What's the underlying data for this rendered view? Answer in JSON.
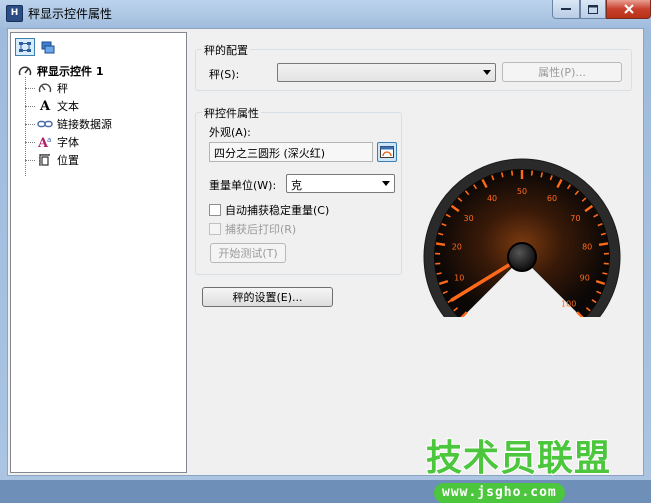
{
  "window": {
    "title": "秤显示控件属性"
  },
  "tree": {
    "root_label": "秤显示控件 1",
    "items": [
      {
        "label": "秤",
        "icon": "scale-gauge-icon"
      },
      {
        "label": "文本",
        "icon": "text-a-icon"
      },
      {
        "label": "链接数据源",
        "icon": "link-icon"
      },
      {
        "label": "字体",
        "icon": "font-icon"
      },
      {
        "label": "位置",
        "icon": "position-icon"
      }
    ]
  },
  "config": {
    "group_title": "秤的配置",
    "scale_label": "秤(S):",
    "scale_value": "",
    "properties_button": "属性(P)..."
  },
  "props": {
    "group_title": "秤控件属性",
    "appearance_label": "外观(A):",
    "appearance_value": "四分之三圆形 (深火红)",
    "unit_label": "重量单位(W):",
    "unit_value": "克",
    "auto_capture_label": "自动捕获稳定重量(C)",
    "print_after_label": "捕获后打印(R)",
    "start_test_button": "开始测试(T)"
  },
  "settings_button": "秤的设置(E)...",
  "gauge": {
    "min": 0,
    "max": 100,
    "value": 5,
    "tick_labels": [
      "10",
      "20",
      "30",
      "40",
      "50",
      "60",
      "70",
      "80",
      "90",
      "100"
    ],
    "accent": "#ff6a1a"
  },
  "watermark": {
    "text": "技术员联盟",
    "url": "www.jsgho.com"
  }
}
